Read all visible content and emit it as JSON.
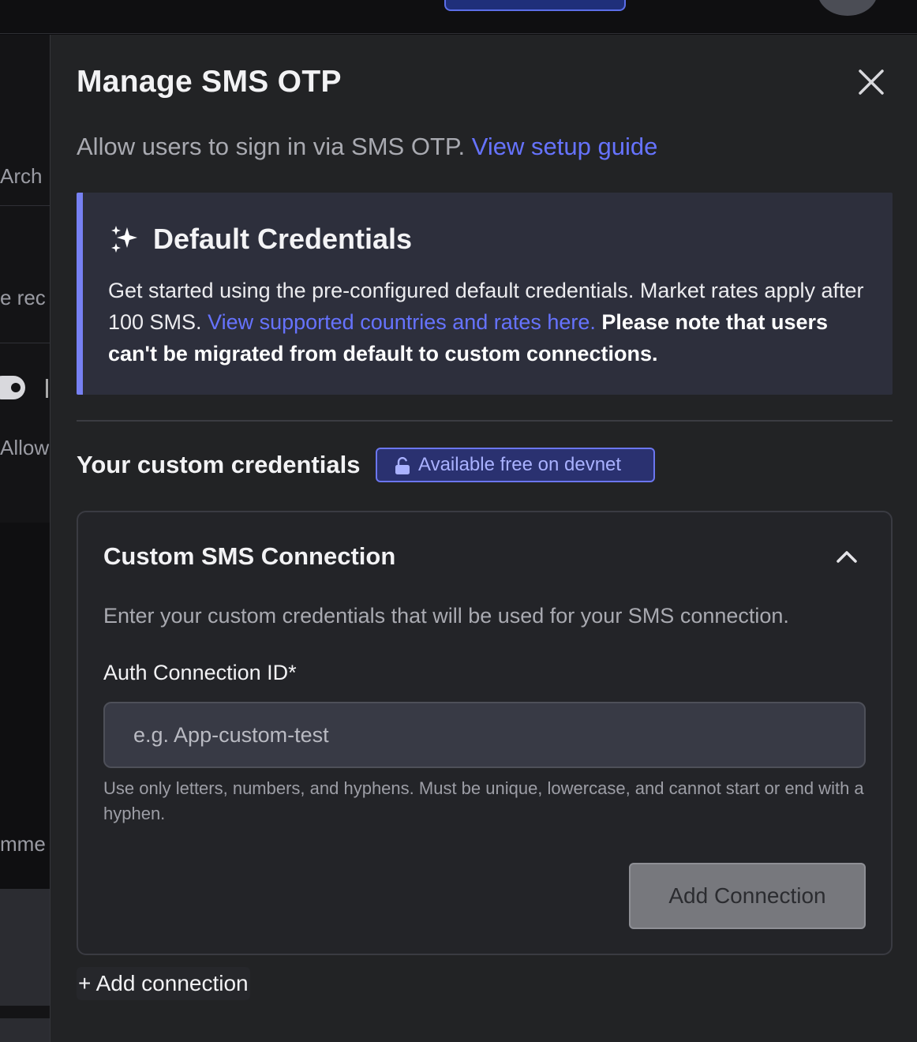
{
  "background": {
    "fragments": [
      "Arch",
      "e rec",
      "Allow",
      "mme"
    ]
  },
  "panel": {
    "title": "Manage SMS OTP",
    "subtitle_text": "Allow users to sign in via SMS OTP.",
    "subtitle_link": "View setup guide"
  },
  "default_credentials": {
    "title": "Default Credentials",
    "text_before": "Get started using the pre-configured default credentials. Market rates apply after 100 SMS.",
    "link": "View supported countries and rates here.",
    "note": "Please note that users can't be migrated from default to custom connections."
  },
  "custom_credentials": {
    "title": "Your custom credentials",
    "badge": "Available free on devnet"
  },
  "connection_card": {
    "title": "Custom SMS Connection",
    "description": "Enter your custom credentials that will be used for your SMS connection.",
    "field_label": "Auth Connection ID*",
    "field_placeholder": "e.g. App-custom-test",
    "field_value": "",
    "help_text": "Use only letters, numbers, and hyphens. Must be unique, lowercase, and cannot start or end with a hyphen.",
    "button_label": "Add Connection"
  },
  "add_connection_link": "+ Add connection",
  "colors": {
    "accent": "#6673ff",
    "panel_bg": "#222325",
    "callout_bg": "#2d2f3c",
    "callout_border": "#7781f3"
  }
}
